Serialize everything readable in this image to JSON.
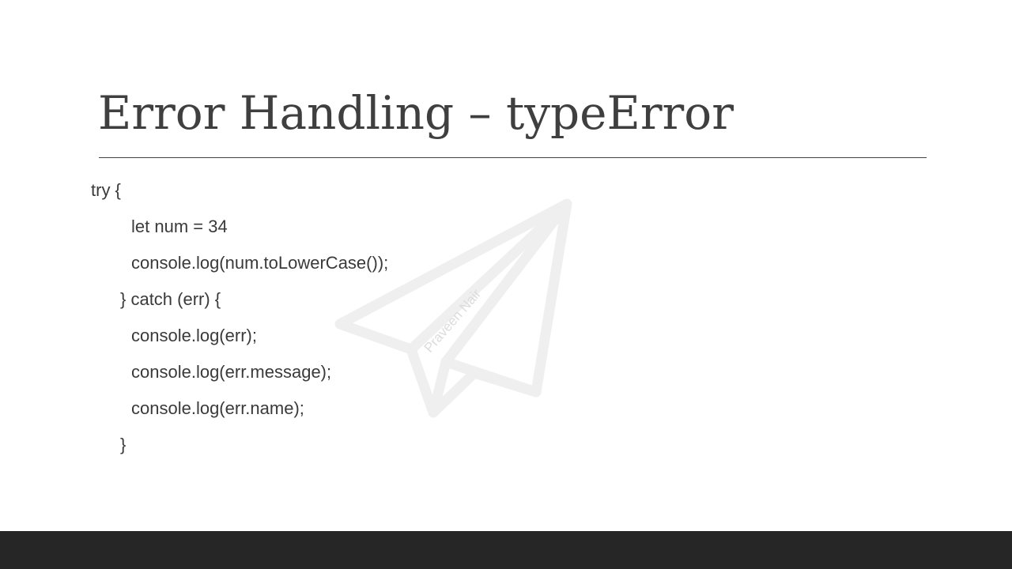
{
  "slide": {
    "title": "Error Handling – typeError",
    "watermark_text": "Praveen Nair",
    "watermark_icon": "paper-plane-icon",
    "code_lines": [
      "try {",
      "let num = 34",
      "console.log(num.toLowerCase());",
      "} catch (err) {",
      "console.log(err);",
      "console.log(err.message);",
      "console.log(err.name);",
      "}"
    ]
  },
  "colors": {
    "title": "#3f3f3f",
    "text": "#3a3a3a",
    "rule": "#404040",
    "watermark": "#efefef",
    "bottom_bar": "#262626",
    "background": "#ffffff"
  }
}
